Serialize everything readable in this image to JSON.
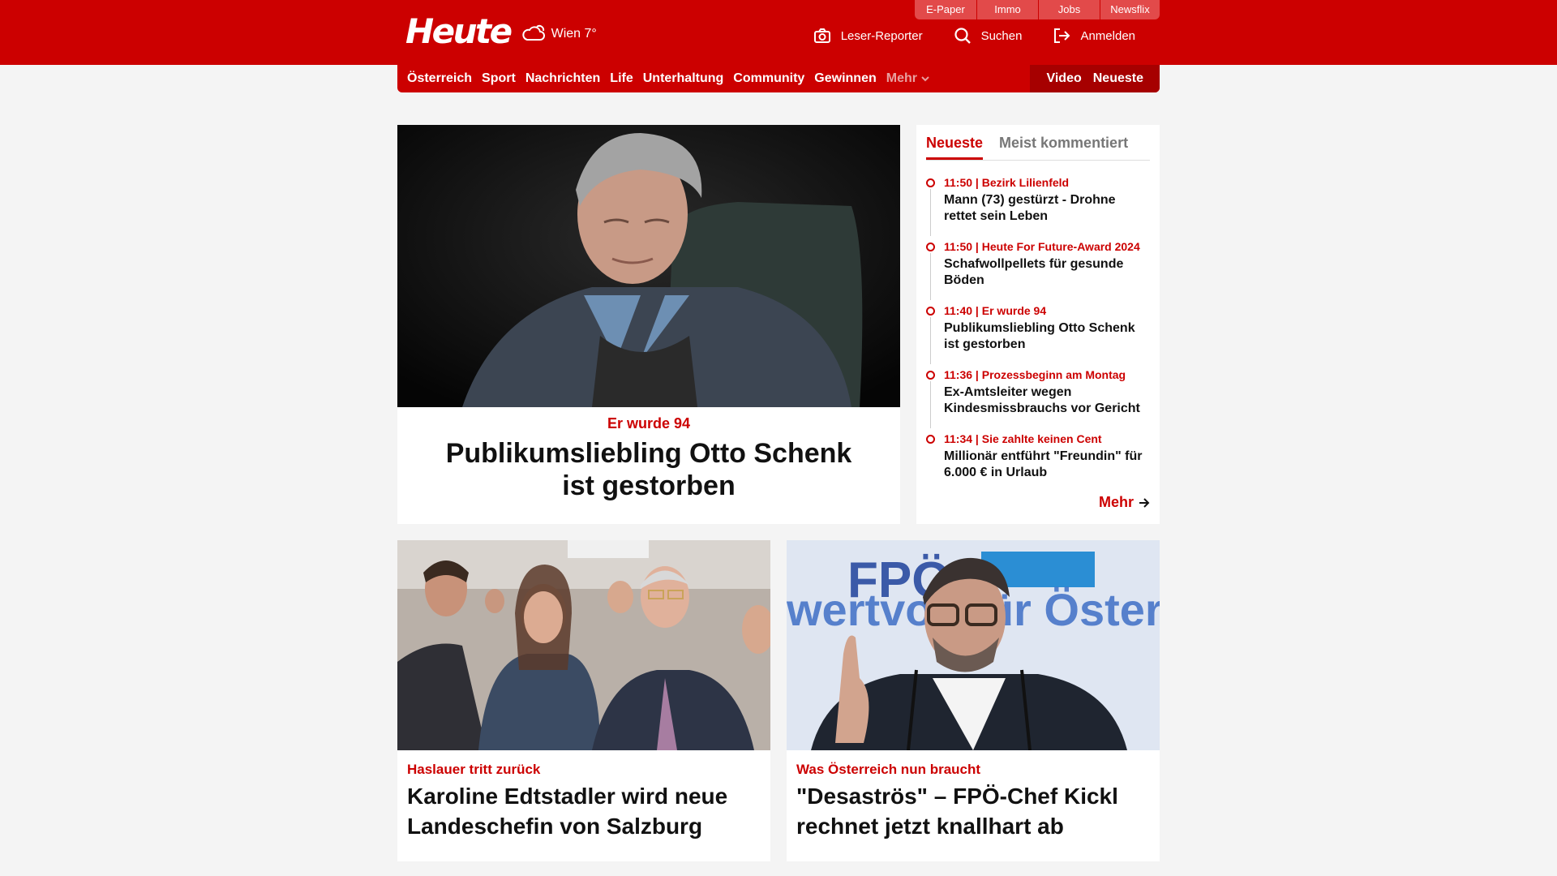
{
  "header": {
    "logo_text": "Heute",
    "weather": "Wien 7°",
    "service_tabs": [
      {
        "label": "E-Paper"
      },
      {
        "label": "Immo"
      },
      {
        "label": "Jobs"
      },
      {
        "label": "Newsflix"
      }
    ],
    "actions": {
      "reporter": "Leser-Reporter",
      "search": "Suchen",
      "login": "Anmelden"
    }
  },
  "nav": {
    "items": [
      {
        "label": "Österreich"
      },
      {
        "label": "Sport"
      },
      {
        "label": "Nachrichten"
      },
      {
        "label": "Life"
      },
      {
        "label": "Unterhaltung"
      },
      {
        "label": "Community"
      },
      {
        "label": "Gewinnen"
      }
    ],
    "more": "Mehr",
    "video": "Video",
    "latest": "Neueste"
  },
  "hero": {
    "kicker": "Er wurde 94",
    "title": "Publikumsliebling Otto Schenk ist gestorben"
  },
  "sidebar": {
    "tab_latest": "Neueste",
    "tab_most_commented": "Meist kommentiert",
    "items": [
      {
        "time": "11:50",
        "category": "Bezirk Lilienfeld",
        "title": "Mann (73) gestürzt - Drohne rettet sein Leben"
      },
      {
        "time": "11:50",
        "category": "Heute For Future-Award 2024",
        "title": "Schafwollpellets für gesunde Böden"
      },
      {
        "time": "11:40",
        "category": "Er wurde 94",
        "title": "Publikumsliebling Otto Schenk ist gestorben"
      },
      {
        "time": "11:36",
        "category": "Prozessbeginn am Montag",
        "title": "Ex-Amtsleiter wegen Kindesmissbrauchs vor Gericht"
      },
      {
        "time": "11:34",
        "category": "Sie zahlte keinen Cent",
        "title": "Millionär entführt \"Freundin\" für 6.000 € in Urlaub"
      }
    ],
    "more": "Mehr"
  },
  "cards": [
    {
      "kicker": "Haslauer tritt zurück",
      "title": "Karoline Edtstadler wird neue Landeschefin von Salzburg"
    },
    {
      "kicker": "Was Österreich nun braucht",
      "title": "\"Desaströs\" – FPÖ-Chef Kickl rechnet jetzt knallhart ab",
      "backdrop_text": "FPÖ",
      "backdrop_text2": "wertvoll für Österreich"
    }
  ],
  "colors": {
    "brand_red": "#cc0000",
    "nav_dark_red": "#a60000",
    "page_bg": "#f4f4f4"
  }
}
